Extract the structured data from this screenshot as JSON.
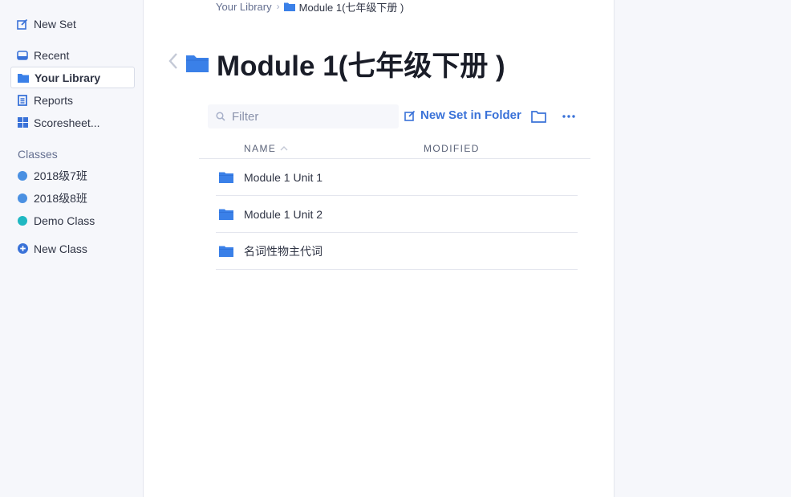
{
  "sidebar": {
    "new_set": "New Set",
    "recent": "Recent",
    "your_library": "Your Library",
    "reports": "Reports",
    "scoresheets": "Scoresheet...",
    "classes_heading": "Classes",
    "classes": [
      {
        "label": "2018级7班",
        "color": "#4a90e2"
      },
      {
        "label": "2018级8班",
        "color": "#4a90e2"
      },
      {
        "label": "Demo Class",
        "color": "#1fb8c2"
      }
    ],
    "new_class": "New Class"
  },
  "breadcrumb": {
    "root": "Your Library",
    "current": "Module 1(七年级下册 )"
  },
  "page": {
    "title": "Module 1(七年级下册 )"
  },
  "toolbar": {
    "filter_placeholder": "Filter",
    "new_set_in_folder": "New Set in Folder"
  },
  "table": {
    "columns": [
      "NAME",
      "MODIFIED"
    ],
    "sort_column": "NAME",
    "rows": [
      {
        "name": "Module 1 Unit 1",
        "modified": ""
      },
      {
        "name": "Module 1 Unit 2",
        "modified": ""
      },
      {
        "name": "名词性物主代词",
        "modified": ""
      }
    ]
  },
  "colors": {
    "accent": "#3a72d8",
    "folder_blue": "#3a80e8",
    "sidebar_bg": "#f6f7fb",
    "text_dark": "#1a1d28"
  }
}
